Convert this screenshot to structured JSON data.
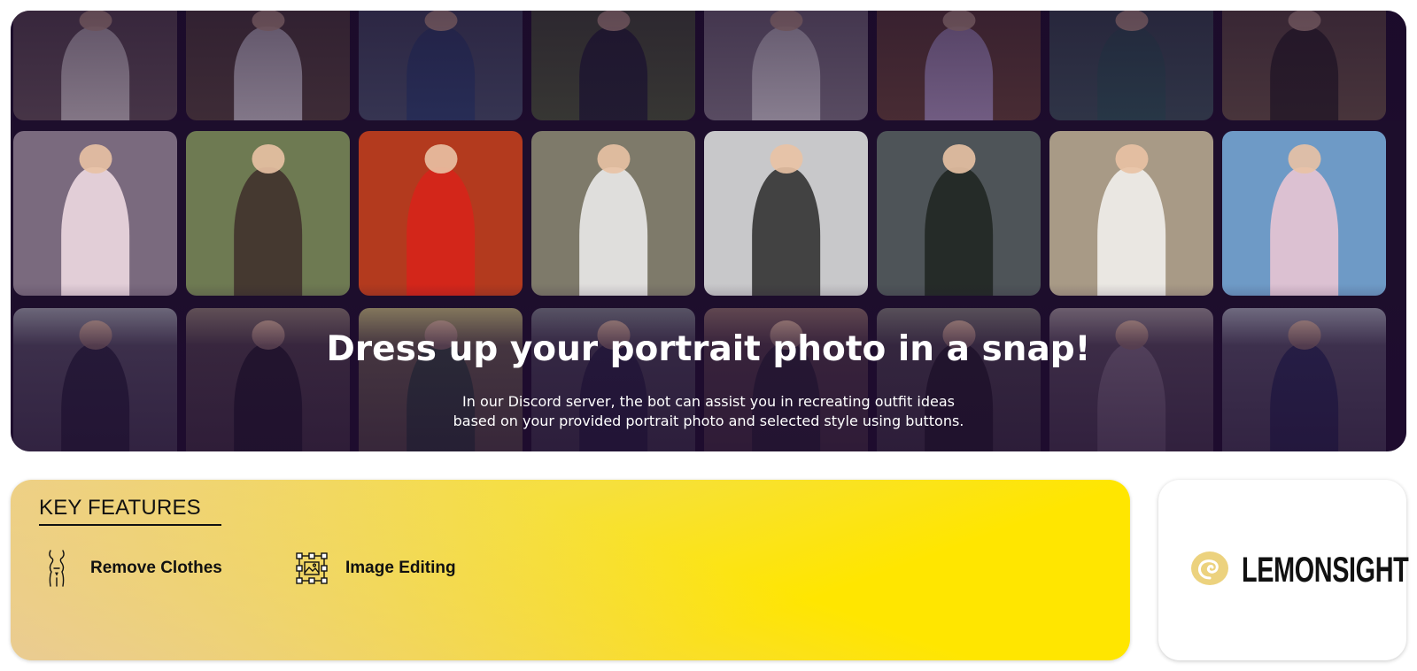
{
  "hero": {
    "title": "Dress up your portrait photo in a snap!",
    "description_line1": "In our Discord server, the bot can assist you in recreating outfit ideas",
    "description_line2": "based on your provided portrait photo and selected style using buttons."
  },
  "features": {
    "heading": "KEY FEATURES",
    "items": [
      {
        "label": "Remove Clothes",
        "icon": "body-silhouette-icon"
      },
      {
        "label": "Image Editing",
        "icon": "image-edit-icon"
      }
    ]
  },
  "brand": {
    "name": "LEMONSIGHT",
    "icon": "lemon-spiral-icon",
    "icon_color": "#ecd27e"
  },
  "colors": {
    "hero_background": "#1d0e2c",
    "features_yellow": "#ffe600",
    "features_peach": "#e8c8a0"
  }
}
